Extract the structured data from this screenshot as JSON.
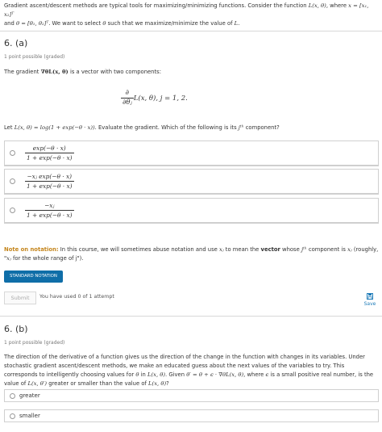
{
  "intro": {
    "text1": "Gradient ascent/descent methods are typical tools for maximizing/minimizing functions. Consider the function ",
    "func": "L(x, θ)",
    "text2": ", where ",
    "xdef": "x = [x₁, x₂]ᵀ",
    "text3": "and ",
    "thetadef": "θ = [θ₁, θ₂]ᵀ",
    "text4": ". We want to select ",
    "theta": "θ",
    "text5": " such that we maximize/minimize the value of ",
    "L": "L",
    "text6": "."
  },
  "q1": {
    "title": "6. (a)",
    "points": "1 point possible (graded)",
    "gradient_text1": "The gradient ",
    "gradient_sym": "∇θL(x, θ)",
    "gradient_text2": " is a vector with two components:",
    "eq_num": "∂",
    "eq_den": "∂θⱼ",
    "eq_rest": "L(x, θ), j = 1, 2.",
    "let_text1": "Let ",
    "let_eq": "L(x, θ) = log(1 + exp(−θ · x))",
    "let_text2": ". Evaluate the gradient. Which of the following is its ",
    "jth": "jᵗʰ",
    "let_text3": " component?",
    "options": [
      {
        "num": "exp(−θ · x)",
        "den": "1 + exp(−θ · x)"
      },
      {
        "num": "−xⱼ exp(−θ · x)",
        "den": "1 + exp(−θ · x)"
      },
      {
        "num": "−xⱼ",
        "den": "1 + exp(−θ · x)"
      }
    ],
    "note_label": "Note on notation:",
    "note_text1": " In this course, we will sometimes abuse notation and use ",
    "note_xj": "xⱼ",
    "note_text2": " to mean the ",
    "note_vector": "vector",
    "note_text3": " whose ",
    "note_jth": "jᵗʰ",
    "note_text4": " component is ",
    "note_xj2": "xⱼ",
    "note_text5": " (roughly, \"",
    "note_xj3": "xⱼ",
    "note_text6": " for the whole range of j\").",
    "std_button": "STANDARD NOTATION",
    "submit_label": "Submit",
    "attempts": "You have used 0 of 1 attempt",
    "save_label": "Save"
  },
  "q2": {
    "title": "6. (b)",
    "points": "1 point possible (graded)",
    "body1": "The direction of the derivative of a function gives us the direction of the change in the function with changes in its variables. Under stochastic gradient ascent/descent methods, we make an educated guess about the next values of the variables to try. This corresponds to intelligently choosing values for ",
    "theta_in": "θ",
    "body2": " in ",
    "L1": "L(x, θ)",
    "body3": ". Given ",
    "update": "θ′ = θ + ϵ · ∇θL(x, θ)",
    "body4": ", where ",
    "eps": "ϵ",
    "body5": " is a small positive real number, is the value of ",
    "L2": "L(x, θ′)",
    "body6": " greater or smaller than the value of ",
    "L3": "L(x, θ)",
    "body7": "?",
    "options": [
      "greater",
      "smaller"
    ]
  }
}
